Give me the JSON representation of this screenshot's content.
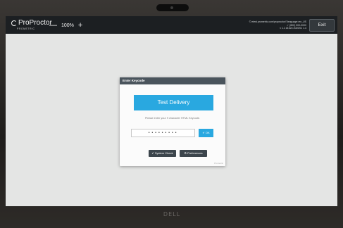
{
  "app": {
    "logo_text": "ProProctor",
    "logo_sub": "PROMETRIC"
  },
  "toolbar": {
    "zoom_out": "—",
    "zoom_level": "100%",
    "zoom_in": "+",
    "info_line1": "© etest.prometric.com/proproctor/?language=en_US",
    "info_line2": "✓ (800) 000-0000",
    "info_line3": "v 1.1 #1024 2020/01 1.4",
    "exit_label": "Exit"
  },
  "dialog": {
    "title": "Enter Keycode",
    "test_delivery_label": "Test Delivery",
    "hint": "Please enter your 9 character HTML Keycode.",
    "keycode_value": "•••••••••",
    "ok_label": "✔ OK",
    "system_check_label": "✔ System Check",
    "preferences_label": "⚙ Preferences",
    "version": "Prometric"
  },
  "bezel": {
    "brand": "DELL"
  }
}
